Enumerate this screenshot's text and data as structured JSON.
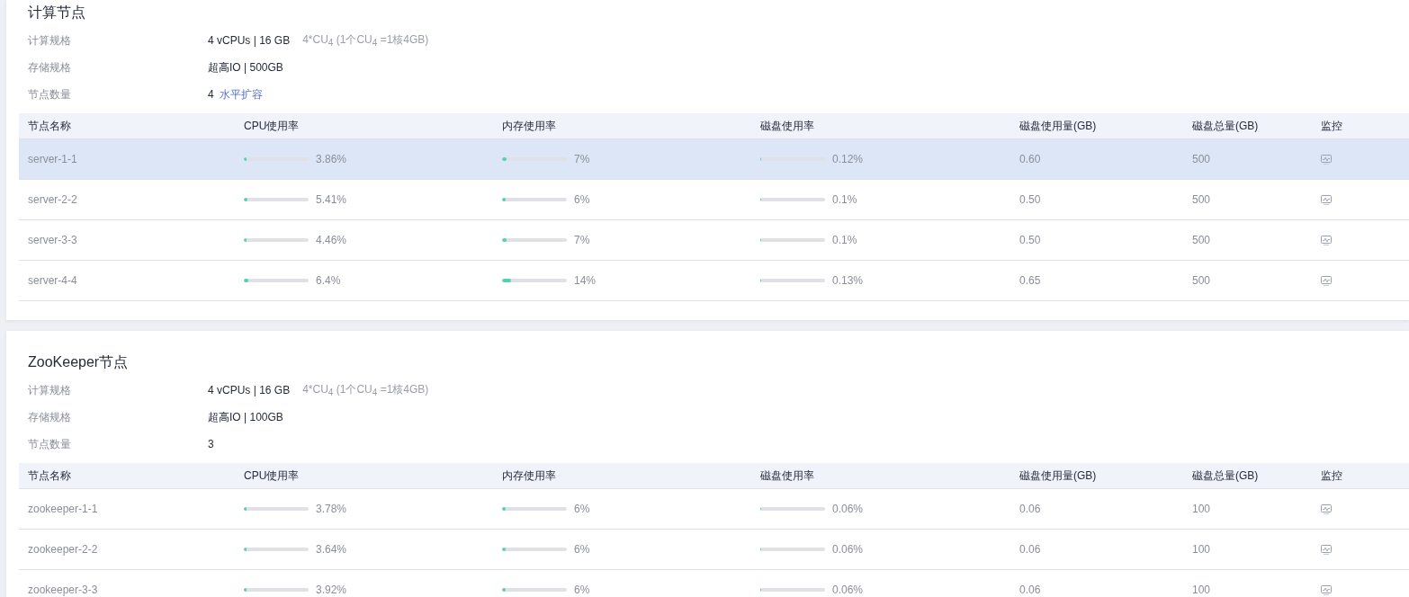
{
  "sections": [
    {
      "title": "计算节点",
      "specs": [
        {
          "label": "计算规格",
          "value": "4 vCPUs | 16 GB",
          "note": "4*CU$_{4}$ (1个CU$_{4}$ =1核4GB)"
        },
        {
          "label": "存储规格",
          "value": "超高IO | 500GB"
        },
        {
          "label": "节点数量",
          "value": "4",
          "link": "水平扩容"
        }
      ],
      "columns": [
        "节点名称",
        "CPU使用率",
        "内存使用率",
        "磁盘使用率",
        "磁盘使用量(GB)",
        "磁盘总量(GB)",
        "监控"
      ],
      "rows": [
        {
          "name": "server-1-1",
          "selected": true,
          "cpu": {
            "level": 0.0386,
            "reading": "3.86%"
          },
          "mem": {
            "level": 0.07,
            "reading": "7%"
          },
          "disk": {
            "level": 0.0012,
            "reading": "0.12%"
          },
          "used": "0.60",
          "total": "500"
        },
        {
          "name": "server-2-2",
          "selected": false,
          "cpu": {
            "level": 0.0541,
            "reading": "5.41%"
          },
          "mem": {
            "level": 0.06,
            "reading": "6%"
          },
          "disk": {
            "level": 0.001,
            "reading": "0.1%"
          },
          "used": "0.50",
          "total": "500"
        },
        {
          "name": "server-3-3",
          "selected": false,
          "cpu": {
            "level": 0.0446,
            "reading": "4.46%"
          },
          "mem": {
            "level": 0.07,
            "reading": "7%"
          },
          "disk": {
            "level": 0.001,
            "reading": "0.1%"
          },
          "used": "0.50",
          "total": "500"
        },
        {
          "name": "server-4-4",
          "selected": false,
          "cpu": {
            "level": 0.064,
            "reading": "6.4%"
          },
          "mem": {
            "level": 0.14,
            "reading": "14%"
          },
          "disk": {
            "level": 0.0013,
            "reading": "0.13%"
          },
          "used": "0.65",
          "total": "500"
        }
      ]
    },
    {
      "title": "ZooKeeper节点",
      "specs": [
        {
          "label": "计算规格",
          "value": "4 vCPUs | 16 GB",
          "note": "4*CU$_{4}$ (1个CU$_{4}$ =1核4GB)"
        },
        {
          "label": "存储规格",
          "value": "超高IO | 100GB"
        },
        {
          "label": "节点数量",
          "value": "3"
        }
      ],
      "columns": [
        "节点名称",
        "CPU使用率",
        "内存使用率",
        "磁盘使用率",
        "磁盘使用量(GB)",
        "磁盘总量(GB)",
        "监控"
      ],
      "rows": [
        {
          "name": "zookeeper-1-1",
          "selected": false,
          "cpu": {
            "level": 0.0378,
            "reading": "3.78%"
          },
          "mem": {
            "level": 0.06,
            "reading": "6%"
          },
          "disk": {
            "level": 0.0006,
            "reading": "0.06%"
          },
          "used": "0.06",
          "total": "100"
        },
        {
          "name": "zookeeper-2-2",
          "selected": false,
          "cpu": {
            "level": 0.0364,
            "reading": "3.64%"
          },
          "mem": {
            "level": 0.06,
            "reading": "6%"
          },
          "disk": {
            "level": 0.0006,
            "reading": "0.06%"
          },
          "used": "0.06",
          "total": "100"
        },
        {
          "name": "zookeeper-3-3",
          "selected": false,
          "cpu": {
            "level": 0.0392,
            "reading": "3.92%"
          },
          "mem": {
            "level": 0.06,
            "reading": "6%"
          },
          "disk": {
            "level": 0.0006,
            "reading": "0.06%"
          },
          "used": "0.06",
          "total": "100"
        }
      ]
    }
  ]
}
